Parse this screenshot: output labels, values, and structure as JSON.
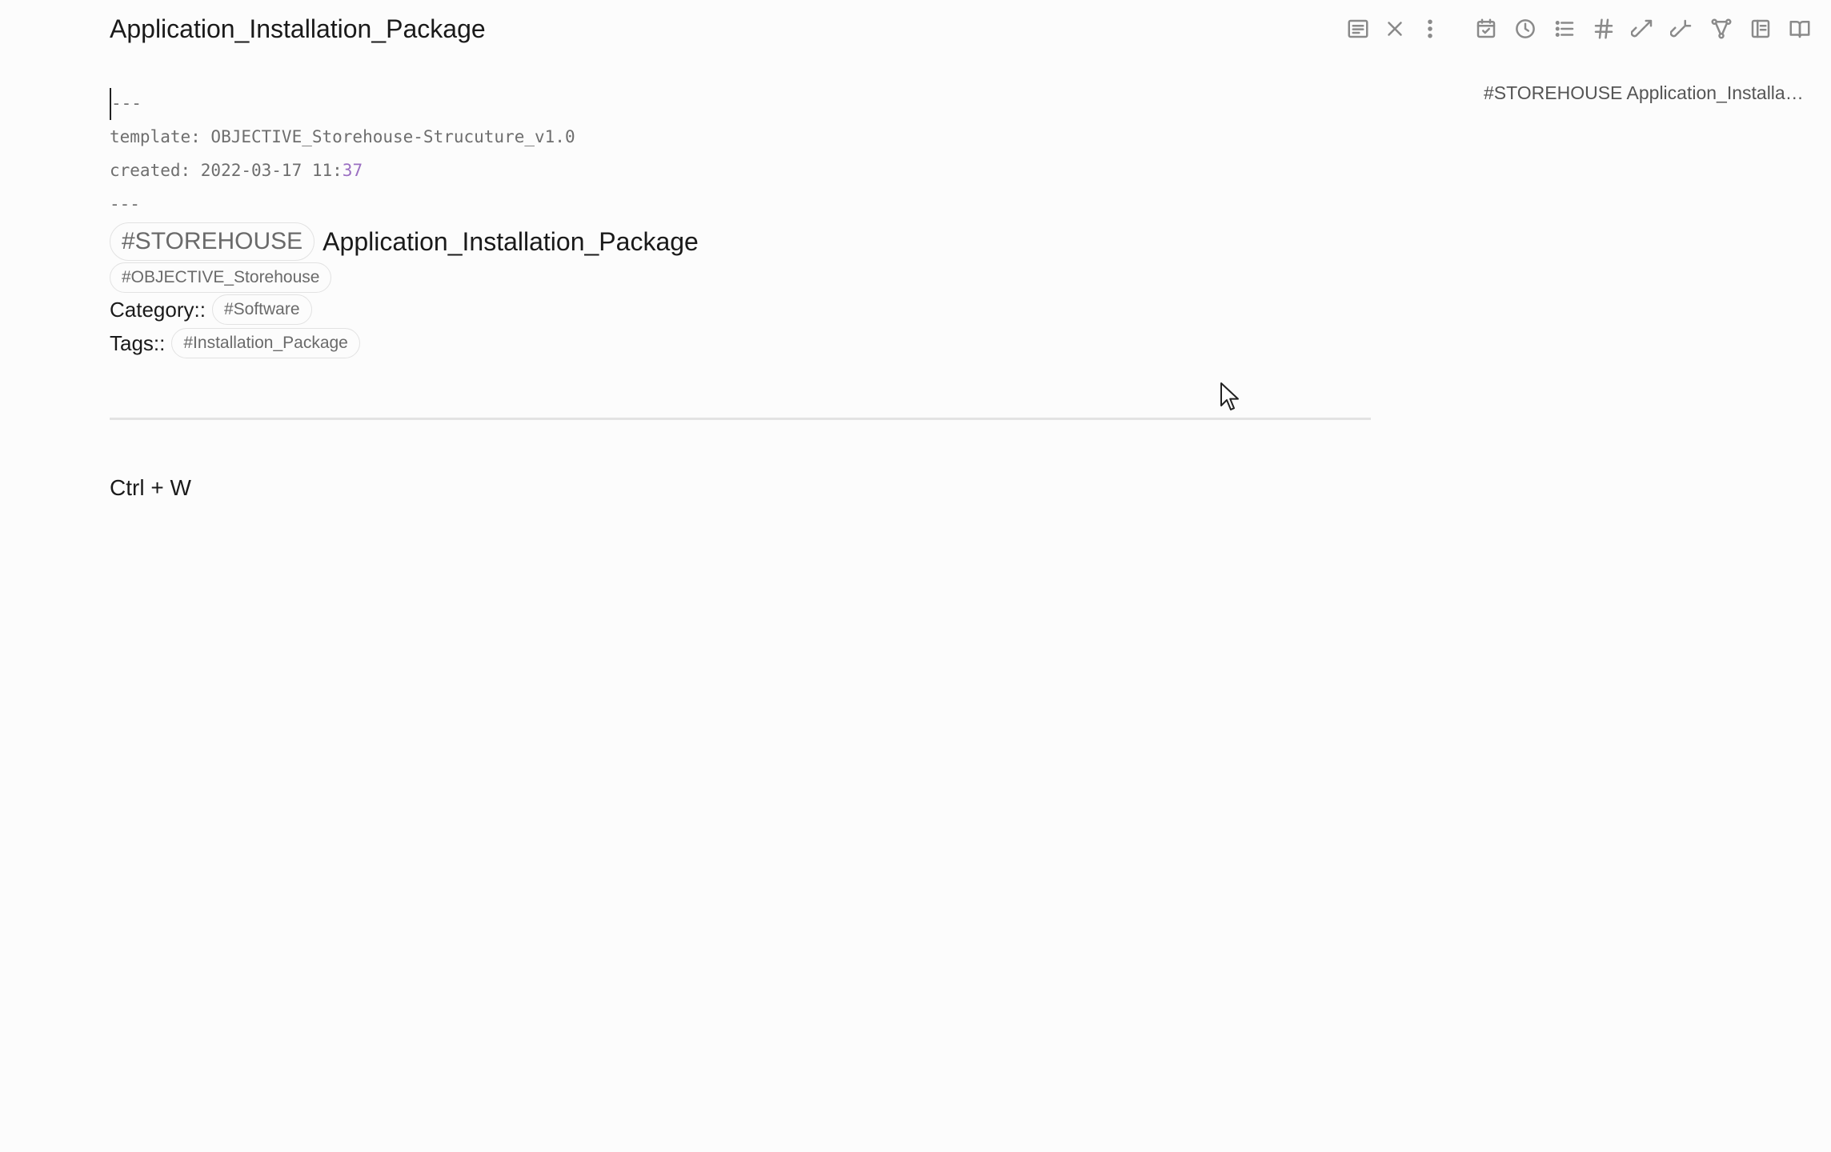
{
  "header": {
    "title": "Application_Installation_Package",
    "icons": [
      "reading-view-icon",
      "close-icon",
      "more-options-icon",
      "calendar-icon",
      "recent-files-icon",
      "outline-list-icon",
      "tags-icon",
      "backlinks-icon",
      "outgoing-links-icon",
      "graph-view-icon",
      "toggle-panel-icon",
      "book-icon"
    ]
  },
  "outline": {
    "item": "#STOREHOUSE Application_Installatio..."
  },
  "editor": {
    "frontmatter_open": "---",
    "template_line": "template: OBJECTIVE_Storehouse-Strucuture_v1.0",
    "created_prefix": "created: 2022-03-17 11:",
    "created_minutes": "37",
    "frontmatter_close": "---",
    "heading_tag": "#STOREHOUSE",
    "heading_text": "Application_Installation_Package",
    "objective_tag": "#OBJECTIVE_Storehouse",
    "category_label": "Category::",
    "category_tag": "#Software",
    "tags_label": "Tags::",
    "tags_tag": "#Installation_Package",
    "body_text": "Ctrl + W"
  },
  "colors": {
    "background": "#fcfcfc",
    "icon": "#8a8a8a",
    "muted_text": "#6e6e6e",
    "accent_number": "#9b6fc2"
  }
}
